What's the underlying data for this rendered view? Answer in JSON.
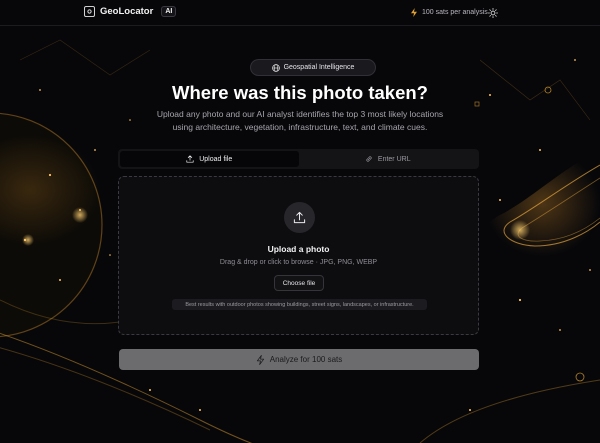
{
  "header": {
    "brand_name": "GeoLocator",
    "badge": "AI",
    "price_text": "100 sats per analysis",
    "icons": {
      "logo": "map-pin-square-icon",
      "price": "bolt-icon",
      "theme": "sun-icon"
    },
    "accent_color": "#e0a030"
  },
  "hero": {
    "pill_label": "Geospatial Intelligence",
    "title": "Where was this photo taken?",
    "subtitle": "Upload any photo and our AI analyst identifies the top 3 most likely locations using architecture, vegetation, infrastructure, text, and climate cues."
  },
  "tabs": [
    {
      "label": "Upload file",
      "icon": "upload-icon",
      "active": true
    },
    {
      "label": "Enter URL",
      "icon": "link-icon",
      "active": false
    }
  ],
  "dropzone": {
    "title": "Upload a photo",
    "subtitle": "Drag & drop or click to browse · JPG, PNG, WEBP",
    "button_label": "Choose file",
    "hint": "Best results with outdoor photos showing buildings, street signs, landscapes, or infrastructure."
  },
  "analyze_button": {
    "label": "Analyze for 100 sats",
    "icon": "bolt-icon"
  }
}
